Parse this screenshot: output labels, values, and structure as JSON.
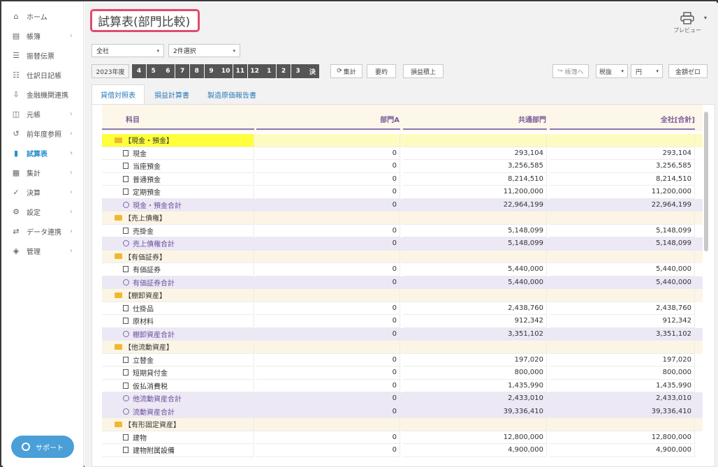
{
  "sidebar": {
    "items": [
      {
        "label": "ホーム",
        "icon": "home-icon",
        "glyph": "⌂",
        "chev": "",
        "active": false
      },
      {
        "label": "帳簿",
        "icon": "book-icon",
        "glyph": "▤",
        "chev": "›",
        "active": false
      },
      {
        "label": "振替伝票",
        "icon": "voucher-icon",
        "glyph": "☰",
        "chev": "",
        "active": false
      },
      {
        "label": "仕訳日記帳",
        "icon": "journal-icon",
        "glyph": "☷",
        "chev": "",
        "active": false
      },
      {
        "label": "金融機関連携",
        "icon": "bank-sync-icon",
        "glyph": "⇩",
        "chev": "",
        "active": false
      },
      {
        "label": "元帳",
        "icon": "ledger-icon",
        "glyph": "◫",
        "chev": "›",
        "active": false
      },
      {
        "label": "前年度参照",
        "icon": "history-icon",
        "glyph": "↺",
        "chev": "›",
        "active": false
      },
      {
        "label": "試算表",
        "icon": "trial-balance-icon",
        "glyph": "▮",
        "chev": "›",
        "active": true
      },
      {
        "label": "集計",
        "icon": "calculator-icon",
        "glyph": "▦",
        "chev": "›",
        "active": false
      },
      {
        "label": "決算",
        "icon": "check-icon",
        "glyph": "✓",
        "chev": "›",
        "active": false
      },
      {
        "label": "設定",
        "icon": "gear-icon",
        "glyph": "⚙",
        "chev": "›",
        "active": false
      },
      {
        "label": "データ連携",
        "icon": "exchange-icon",
        "glyph": "⇄",
        "chev": "›",
        "active": false
      },
      {
        "label": "管理",
        "icon": "layers-icon",
        "glyph": "◈",
        "chev": "›",
        "active": false
      }
    ]
  },
  "support_label": "サポート",
  "page_title": "試算表(部門比較)",
  "preview_label": "プレビュー",
  "filters": {
    "company": "全社",
    "departments": "2件選択"
  },
  "toolbar": {
    "year": "2023年度",
    "months": [
      "4",
      "5",
      "6",
      "7",
      "8",
      "9",
      "10",
      "11",
      "12",
      "1",
      "2",
      "3",
      "決"
    ],
    "aggregate": "集計",
    "summary": "要約",
    "pl_accum": "損益積上",
    "ledger_link": "帳簿へ",
    "tax": "税抜",
    "unit": "円",
    "zero": "金額ゼロ"
  },
  "tabs": [
    "貸借対照表",
    "損益計算書",
    "製造原価報告書"
  ],
  "table": {
    "headers": [
      "科目",
      "部門A",
      "共通部門",
      "全社[合計]"
    ],
    "rows": [
      {
        "type": "cat",
        "name": "【現金・預金】",
        "a": "",
        "b": "",
        "c": "",
        "hl": true
      },
      {
        "type": "acc",
        "name": "現金",
        "a": "0",
        "b": "293,104",
        "c": "293,104"
      },
      {
        "type": "acc",
        "name": "当座預金",
        "a": "0",
        "b": "3,256,585",
        "c": "3,256,585"
      },
      {
        "type": "acc",
        "name": "普通預金",
        "a": "0",
        "b": "8,214,510",
        "c": "8,214,510"
      },
      {
        "type": "acc",
        "name": "定期預金",
        "a": "0",
        "b": "11,200,000",
        "c": "11,200,000"
      },
      {
        "type": "sum",
        "name": "現金・預金合計",
        "a": "0",
        "b": "22,964,199",
        "c": "22,964,199"
      },
      {
        "type": "cat",
        "name": "【売上債権】",
        "a": "",
        "b": "",
        "c": ""
      },
      {
        "type": "acc",
        "name": "売掛金",
        "a": "0",
        "b": "5,148,099",
        "c": "5,148,099"
      },
      {
        "type": "sum",
        "name": "売上債権合計",
        "a": "0",
        "b": "5,148,099",
        "c": "5,148,099"
      },
      {
        "type": "cat",
        "name": "【有価証券】",
        "a": "",
        "b": "",
        "c": ""
      },
      {
        "type": "acc",
        "name": "有価証券",
        "a": "0",
        "b": "5,440,000",
        "c": "5,440,000"
      },
      {
        "type": "sum",
        "name": "有価証券合計",
        "a": "0",
        "b": "5,440,000",
        "c": "5,440,000"
      },
      {
        "type": "cat",
        "name": "【棚卸資産】",
        "a": "",
        "b": "",
        "c": ""
      },
      {
        "type": "acc",
        "name": "仕掛品",
        "a": "0",
        "b": "2,438,760",
        "c": "2,438,760"
      },
      {
        "type": "acc",
        "name": "原材料",
        "a": "0",
        "b": "912,342",
        "c": "912,342"
      },
      {
        "type": "sum",
        "name": "棚卸資産合計",
        "a": "0",
        "b": "3,351,102",
        "c": "3,351,102"
      },
      {
        "type": "cat",
        "name": "【他流動資産】",
        "a": "",
        "b": "",
        "c": ""
      },
      {
        "type": "acc",
        "name": "立替金",
        "a": "0",
        "b": "197,020",
        "c": "197,020"
      },
      {
        "type": "acc",
        "name": "短期貸付金",
        "a": "0",
        "b": "800,000",
        "c": "800,000"
      },
      {
        "type": "acc",
        "name": "仮払消費税",
        "a": "0",
        "b": "1,435,990",
        "c": "1,435,990"
      },
      {
        "type": "sum",
        "name": "他流動資産合計",
        "a": "0",
        "b": "2,433,010",
        "c": "2,433,010"
      },
      {
        "type": "sum",
        "name": "流動資産合計",
        "a": "0",
        "b": "39,336,410",
        "c": "39,336,410"
      },
      {
        "type": "cat",
        "name": "【有形固定資産】",
        "a": "",
        "b": "",
        "c": ""
      },
      {
        "type": "acc",
        "name": "建物",
        "a": "0",
        "b": "12,800,000",
        "c": "12,800,000"
      },
      {
        "type": "acc",
        "name": "建物附属設備",
        "a": "0",
        "b": "4,900,000",
        "c": "4,900,000"
      }
    ]
  }
}
